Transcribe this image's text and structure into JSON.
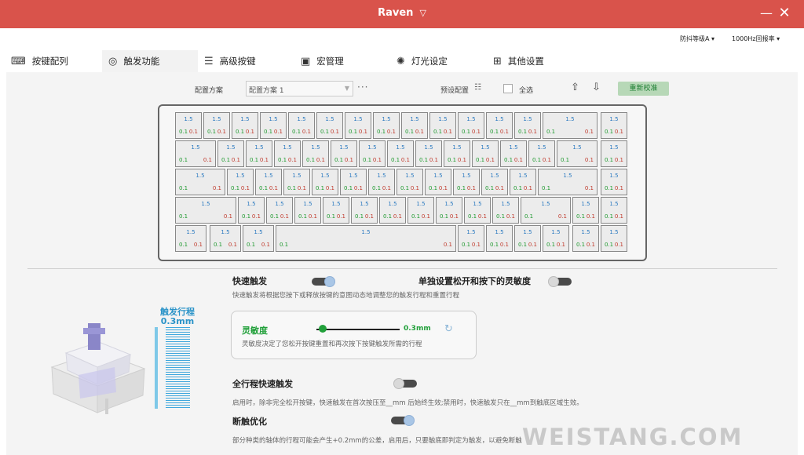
{
  "window": {
    "title": "Raven",
    "title_caret": "▽",
    "minimize": "—",
    "close": "✕"
  },
  "top_options": {
    "debounce": "防抖等级A ▾",
    "polling": "1000Hz回报率 ▾"
  },
  "tabs": [
    {
      "label": "按键配列",
      "icon": "keyboard-icon",
      "glyph": "⌨"
    },
    {
      "label": "触发功能",
      "icon": "trigger-icon",
      "glyph": "◎"
    },
    {
      "label": "高级按键",
      "icon": "sliders-icon",
      "glyph": "☰"
    },
    {
      "label": "宏管理",
      "icon": "macro-icon",
      "glyph": "▣"
    },
    {
      "label": "灯光设定",
      "icon": "light-icon",
      "glyph": "✺"
    },
    {
      "label": "其他设置",
      "icon": "grid-icon",
      "glyph": "⊞"
    }
  ],
  "toolbar": {
    "profile_label": "配置方案",
    "profile_value": "配置方案 1",
    "more": "···",
    "preset_label": "预设配置",
    "select_all": "全选",
    "upload_glyph": "⇧",
    "download_glyph": "⇩",
    "recalibrate": "重新校准"
  },
  "key_values": {
    "actuation": "1.5",
    "press_sens": "0.1",
    "release_sens": "0.1"
  },
  "travel": {
    "label": "触发行程",
    "value": "0.3mm"
  },
  "rapid_trigger": {
    "title": "快速触发",
    "desc": "快速触发将根据您按下或释放按键的意图动态地调整您的触发行程和重置行程",
    "enabled": true
  },
  "separate_sens": {
    "title": "单独设置松开和按下的灵敏度",
    "enabled": false
  },
  "sensitivity": {
    "title": "灵敏度",
    "value": "0.3mm",
    "level": 0.05,
    "desc": "灵敏度决定了您松开按键重置和再次按下按键触发所需的行程"
  },
  "full_travel": {
    "title": "全行程快速触发",
    "desc": "启用时，除非完全松开按键，快速触发在首次按压至__mm 后始终生效;禁用时，快速触发只在__mm到触底区域生效。",
    "enabled": false
  },
  "break_opt": {
    "title": "断触优化",
    "desc": "部分种类的轴体的行程可能会产生+0.2mm的公差，启用后，只要触底即判定为触发，以避免断触",
    "enabled": true
  },
  "watermark": "WEISTANG.COM",
  "colors": {
    "titlebar": "#d9534b",
    "actuation": "#2a79c0",
    "press": "#1f9a2f",
    "release": "#c0392b",
    "accent_green": "#21a03a"
  }
}
